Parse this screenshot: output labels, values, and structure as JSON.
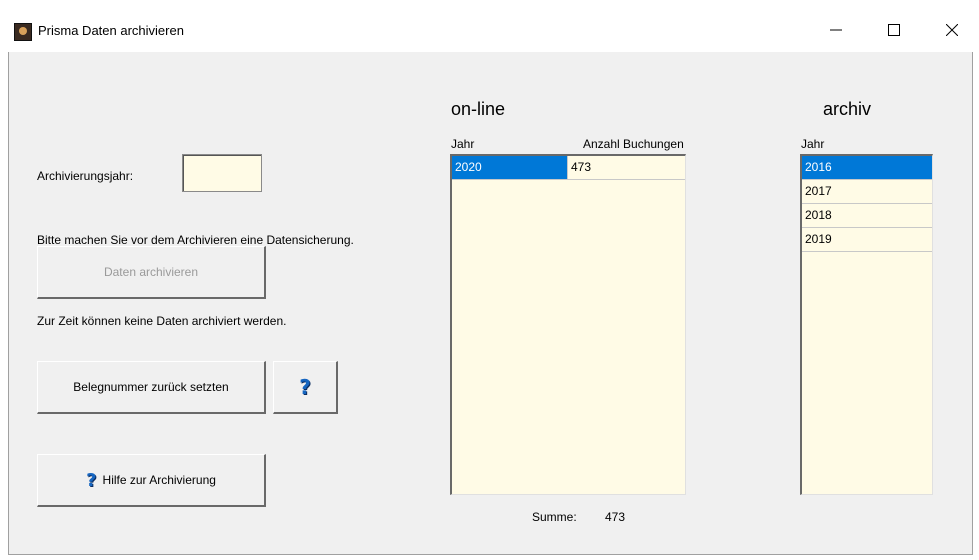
{
  "window": {
    "title": "Prisma Daten archivieren",
    "controls": {
      "minimize": "—",
      "maximize": "☐",
      "close": "✕"
    }
  },
  "left": {
    "year_label": "Archivierungsjahr:",
    "year_value": "",
    "backup_notice": "Bitte machen Sie vor dem Archivieren eine Datensicherung.",
    "archive_button": "Daten archivieren",
    "status_text": "Zur Zeit können keine Daten archiviert werden.",
    "reset_button": "Belegnummer zurück setzten",
    "help_icon_button": "?",
    "help_button": "Hilfe zur Archivierung"
  },
  "online": {
    "heading": "on-line",
    "col_year": "Jahr",
    "col_count": "Anzahl Buchungen",
    "rows": [
      {
        "year": "2020",
        "count": "473"
      }
    ],
    "sum_label": "Summe:",
    "sum_value": "473"
  },
  "archive": {
    "heading": "archiv",
    "col_year": "Jahr",
    "rows": [
      "2016",
      "2017",
      "2018",
      "2019"
    ]
  },
  "colors": {
    "selection": "#0078d7",
    "list_bg": "#fffbe6",
    "window_bg": "#f0f0f0",
    "help_icon": "#1565c0"
  }
}
